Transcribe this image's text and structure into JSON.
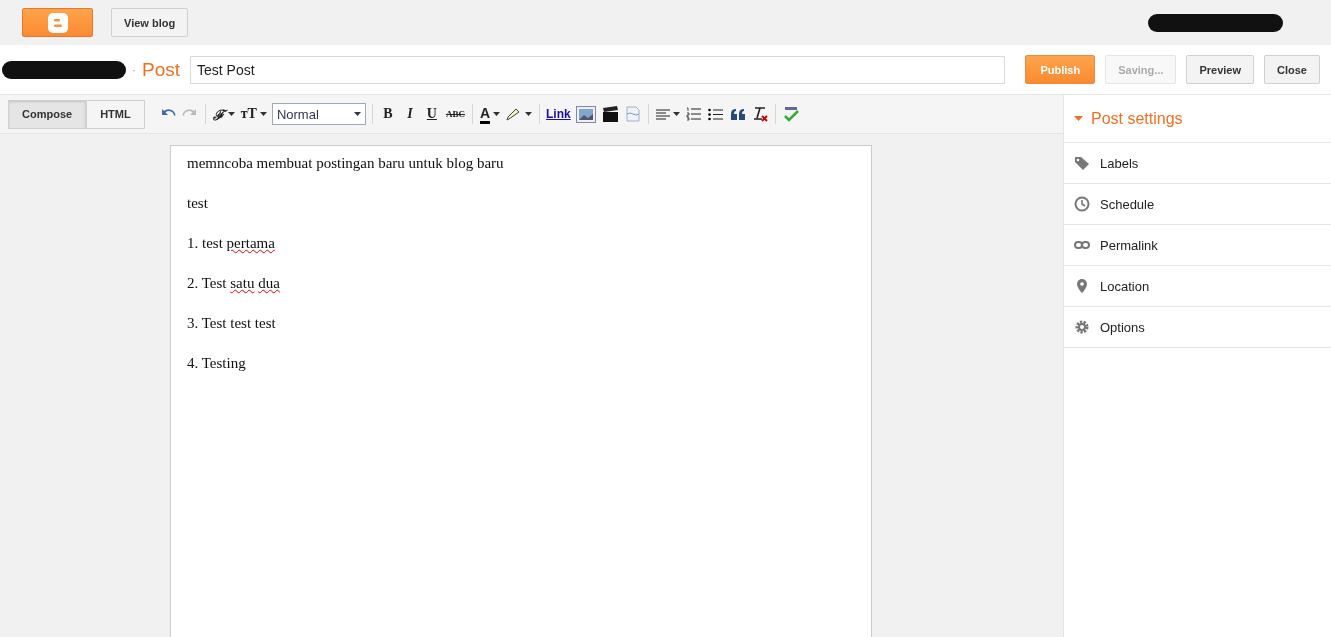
{
  "topbar": {
    "view_blog": "View blog"
  },
  "header": {
    "separator": "·",
    "section": "Post",
    "title_value": "Test Post",
    "buttons": [
      {
        "label": "Publish",
        "kind": "primary",
        "disabled": false
      },
      {
        "label": "Saving...",
        "kind": "plain",
        "disabled": true
      },
      {
        "label": "Preview",
        "kind": "plain",
        "disabled": false
      },
      {
        "label": "Close",
        "kind": "plain",
        "disabled": false
      }
    ]
  },
  "modes": [
    {
      "label": "Compose",
      "selected": true
    },
    {
      "label": "HTML",
      "selected": false
    }
  ],
  "toolbar": {
    "font": "ℱ",
    "font_size": "тT",
    "format": "Normal",
    "bold": "B",
    "italic": "I",
    "underline": "U",
    "strike": "ABC",
    "text_color": "A",
    "link": "Link"
  },
  "editor": {
    "paragraphs": [
      {
        "segments": [
          {
            "text": "memncoba membuat postingan baru untuk blog baru",
            "misspelled": false
          }
        ]
      },
      {
        "segments": [
          {
            "text": "test",
            "misspelled": false
          }
        ]
      },
      {
        "segments": [
          {
            "text": "1. test",
            "misspelled": false
          },
          {
            "text": "pertama",
            "misspelled": true
          }
        ]
      },
      {
        "segments": [
          {
            "text": "2. Test",
            "misspelled": false
          },
          {
            "text": "satu",
            "misspelled": true
          },
          {
            "text": "dua",
            "misspelled": true
          }
        ]
      },
      {
        "segments": [
          {
            "text": "3. Test test test",
            "misspelled": false
          }
        ]
      },
      {
        "segments": [
          {
            "text": "4. Testing",
            "misspelled": false
          }
        ]
      }
    ]
  },
  "post_settings": {
    "title": "Post settings",
    "expanded": true,
    "items": [
      {
        "label": "Labels",
        "kind": "labels"
      },
      {
        "label": "Schedule",
        "kind": "schedule"
      },
      {
        "label": "Permalink",
        "kind": "permalink"
      },
      {
        "label": "Location",
        "kind": "location"
      },
      {
        "label": "Options",
        "kind": "options"
      }
    ]
  }
}
